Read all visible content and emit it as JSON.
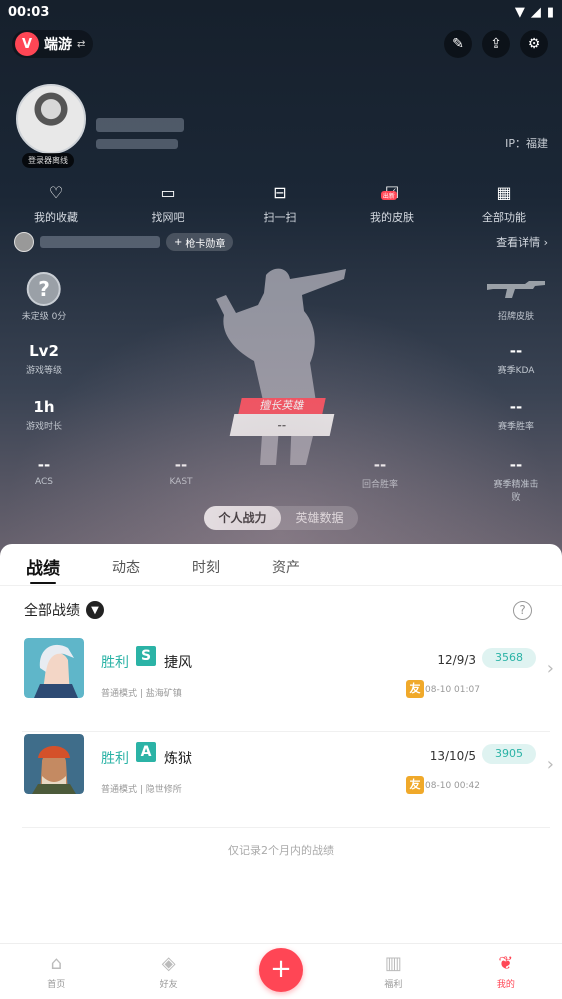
{
  "status_bar": {
    "time": "00:03"
  },
  "header": {
    "app_name": "端游",
    "avatar_badge": "登录器离线",
    "ip_label": "IP：福建"
  },
  "quick_actions": [
    {
      "label": "我的收藏",
      "icon": "heart-icon"
    },
    {
      "label": "找网吧",
      "icon": "monitor-icon"
    },
    {
      "label": "扫一扫",
      "icon": "scan-icon"
    },
    {
      "label": "我的皮肤",
      "icon": "skin-icon",
      "tag": "出新"
    },
    {
      "label": "全部功能",
      "icon": "grid-icon"
    }
  ],
  "badge_row": {
    "add_badge": "枪卡勋章",
    "view_detail": "查看详情"
  },
  "stats": {
    "rank": {
      "value": "?",
      "label": "未定级 0分"
    },
    "skin": {
      "label": "招牌皮肤"
    },
    "level": {
      "value": "Lv2",
      "label": "游戏等级"
    },
    "season_kda": {
      "value": "--",
      "label": "赛季KDA"
    },
    "play_time": {
      "value": "1h",
      "label": "游戏时长"
    },
    "season_winrate": {
      "value": "--",
      "label": "赛季胜率"
    },
    "acs": {
      "value": "--",
      "label": "ACS"
    },
    "kast": {
      "value": "--",
      "label": "KAST"
    },
    "round_winrate": {
      "value": "--",
      "label": "回合胜率"
    },
    "headshot": {
      "value": "--",
      "label": "赛季精准击败"
    },
    "best_hero": {
      "tag": "擅长英雄",
      "value": "--"
    }
  },
  "segment": {
    "options": [
      "个人战力",
      "英雄数据"
    ],
    "active": 0
  },
  "tabs": [
    "战绩",
    "动态",
    "时刻",
    "资产"
  ],
  "filter_label": "全部战绩",
  "matches": [
    {
      "result": "胜利",
      "grade": "S",
      "agent": "捷风",
      "kda": "12/9/3",
      "score": "3568",
      "mode": "普通模式 | 盐海矿镇",
      "friend": "友",
      "time": "08-10 01:07"
    },
    {
      "result": "胜利",
      "grade": "A",
      "agent": "炼狱",
      "kda": "13/10/5",
      "score": "3905",
      "mode": "普通模式 | 隐世修所",
      "friend": "友",
      "time": "08-10 00:42"
    }
  ],
  "footnote": "仅记录2个月内的战绩",
  "bottom_nav": [
    {
      "label": "首页",
      "icon": "home-icon"
    },
    {
      "label": "好友",
      "icon": "friends-icon"
    },
    {
      "label": "福利",
      "icon": "gift-icon"
    },
    {
      "label": "我的",
      "icon": "profile-icon"
    }
  ],
  "colors": {
    "accent": "#ff4655",
    "win": "#2bb3a6",
    "friend": "#f0a92a"
  }
}
